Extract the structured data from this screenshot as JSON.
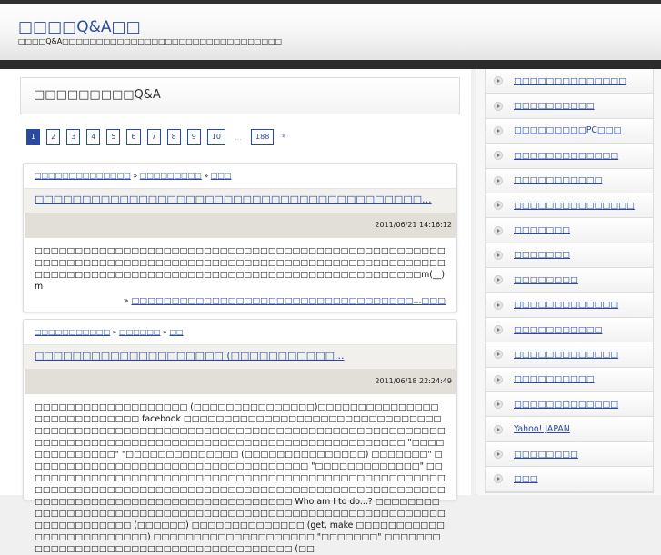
{
  "site": {
    "title": "□□□□Q&A□□",
    "description": "□□□□Q&A□□□□□□□□□□□□□□□□□□□□□□□□□□□□□□□□"
  },
  "page_title": "□□□□□□□□□Q&A",
  "pagination": {
    "pages": [
      "1",
      "2",
      "3",
      "4",
      "5",
      "6",
      "7",
      "8",
      "9",
      "10"
    ],
    "ellipsis": "...",
    "last": "188",
    "next": "»",
    "current": "1"
  },
  "posts": [
    {
      "crumbs": [
        "□□□□□□□□□□□□□□",
        "□□□□□□□□□",
        "□□□"
      ],
      "title": "□□□□□□□□□□□□□□□□□□□□□□□□□□□□□□□□□□□□□□□□□...",
      "date": "2011/06/21 14:16:12",
      "body": "□□□□□□□□□□□□□□□□□□□□□□□□□□□□□□□□□□□□□□□□□□□□□□□□□□□□□□□□□□□□□□□□□□□□□□□□□□□□□□□□□□□□□□□□□□□□□□□□□□□□□□□□□□□□□□□□□□□□□□□□□□□□□□□□□□□□□□□□□□□□□□□□□□□□□□m(__)m",
      "more_prefix": "»",
      "more": "□□□□□□□□□□□□□□□□□□□□□□□□□□□□□□□□□□□...□□□"
    },
    {
      "crumbs": [
        "□□□□□□□□□□□",
        "□□□□□□",
        "□□"
      ],
      "title": "□□□□□□□□□□□□□□□□□□□□ (□□□□□□□□□□□...",
      "date": "2011/06/18 22:24:49",
      "body": "□□□□□□□□□□□□□□□□□□□ (□□□□□□□□□□□□□□□)□□□□□□□□□□□□□□□□□□□□□□□□□□□□ facebook □□□□□□□□□□□□□□□□□□□□□□□□□□□□□□□□□□□□□□□□□□□□□□□□□□□□□□□□□□□□□□□□□□□□□□□□□□□□□□□□□□□□□□□□□□□□□□□□□□□□□□□□□□□□□□□□□□□□□□□□□□□□□□□□□ \"□□□□□□□□□□□□□□\" \"□□□□□□□□□□□□□□ (□□□□□□□□□□□□□□□) □□□□□□□\" □□□□□□□□□□□□□□□□□□□□□□□□□□□□□□□□□□□ \"□□□□□□□□□□□□□\" □□□□□□□□□□□□□□□□□□□□□□□□□□□□□□□□□□□□□□□□□□□□□□□□□□□□□□□□□□□□□□□□□□□□□□□□□□□□□□□□□□□□□□□□□□□□□□□□□□□□□□□□□□□□□□□□□□□□□□□□□□□□□□□□□□□□□□□□ Who am I to do...? □□□□□□□□□□□□□□□□□□□□□□□□□□□□□□□□□□□□□□□□□□□□□□□□□□□□□□□□□□□□□□□□□□□□□□□ (□□□□□□) □□□□□□□□□□□□□□ (get, make □□□□□□□□□□□□□□□□□□□□□□□□□) □□□□□□□□□□□□□□□□□□□□ \"□□□□□□□\" □□□□□□□□□□□□□□□□□□□□□□□□□□□□□□□□□□□□□□□ (□□"
    }
  ],
  "sidebar": {
    "items": [
      "□□□□□□□□□□□□□□",
      "□□□□□□□□□□",
      "□□□□□□□□□PC□□□",
      "□□□□□□□□□□□□□",
      "□□□□□□□□□□□",
      "□□□□□□□□□□□□□□□",
      "□□□□□□□",
      "□□□□□□□",
      "□□□□□□□□",
      "□□□□□□□□□□□□□",
      "□□□□□□□□□□□",
      "□□□□□□□□□□□□□",
      "□□□□□□□□□□",
      "□□□□□□□□□□□□□",
      "Yahoo! JAPAN",
      "□□□□□□□□",
      "□□□"
    ]
  }
}
